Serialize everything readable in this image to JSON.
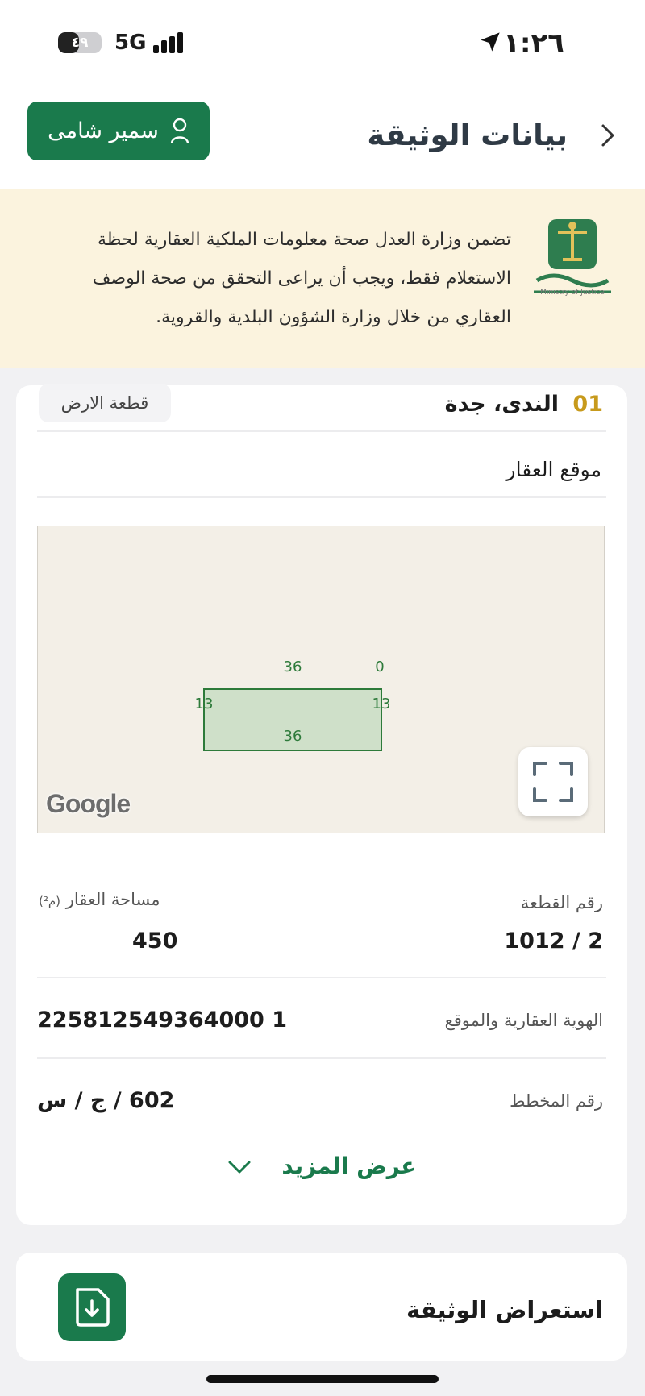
{
  "status_bar": {
    "time": "١:٢٦",
    "battery": "٤٩",
    "battery_level": 0.49,
    "network": "5G"
  },
  "header": {
    "title": "بيانات الوثيقة",
    "user_name": "سمير شامى"
  },
  "notice": {
    "text": "تضمن وزارة العدل صحة معلومات الملكية العقارية لحظة الاستعلام فقط، ويجب أن يراعى التحقق من صحة الوصف العقاري من خلال وزارة الشؤون البلدية والقروية.",
    "logo_caption": "Ministry of Justice"
  },
  "property": {
    "index": "01",
    "location_name": "الندى، جدة",
    "type_badge": "قطعة الارض",
    "location_label": "موقع العقار",
    "map": {
      "top_label": "36",
      "bottom_label": "36",
      "left_label": "13",
      "right_label": "13",
      "corner_label": "0",
      "provider": "Google"
    },
    "plot_number_label": "رقم القطعة",
    "plot_number": "2 / 1012",
    "area_label": "مساحة العقار",
    "area_unit": "(م²)",
    "area_value": "450",
    "property_id_label": "الهوية العقارية والموقع",
    "property_id": "225812549364000 1",
    "plan_label": "رقم المخطط",
    "plan_number": "602 / ج / س",
    "show_more": "عرض المزيد"
  },
  "document": {
    "label": "استعراض الوثيقة"
  },
  "colors": {
    "primary_green": "#1a7a4c",
    "notice_bg": "#fbf3de",
    "accent_gold": "#c79a1c"
  }
}
